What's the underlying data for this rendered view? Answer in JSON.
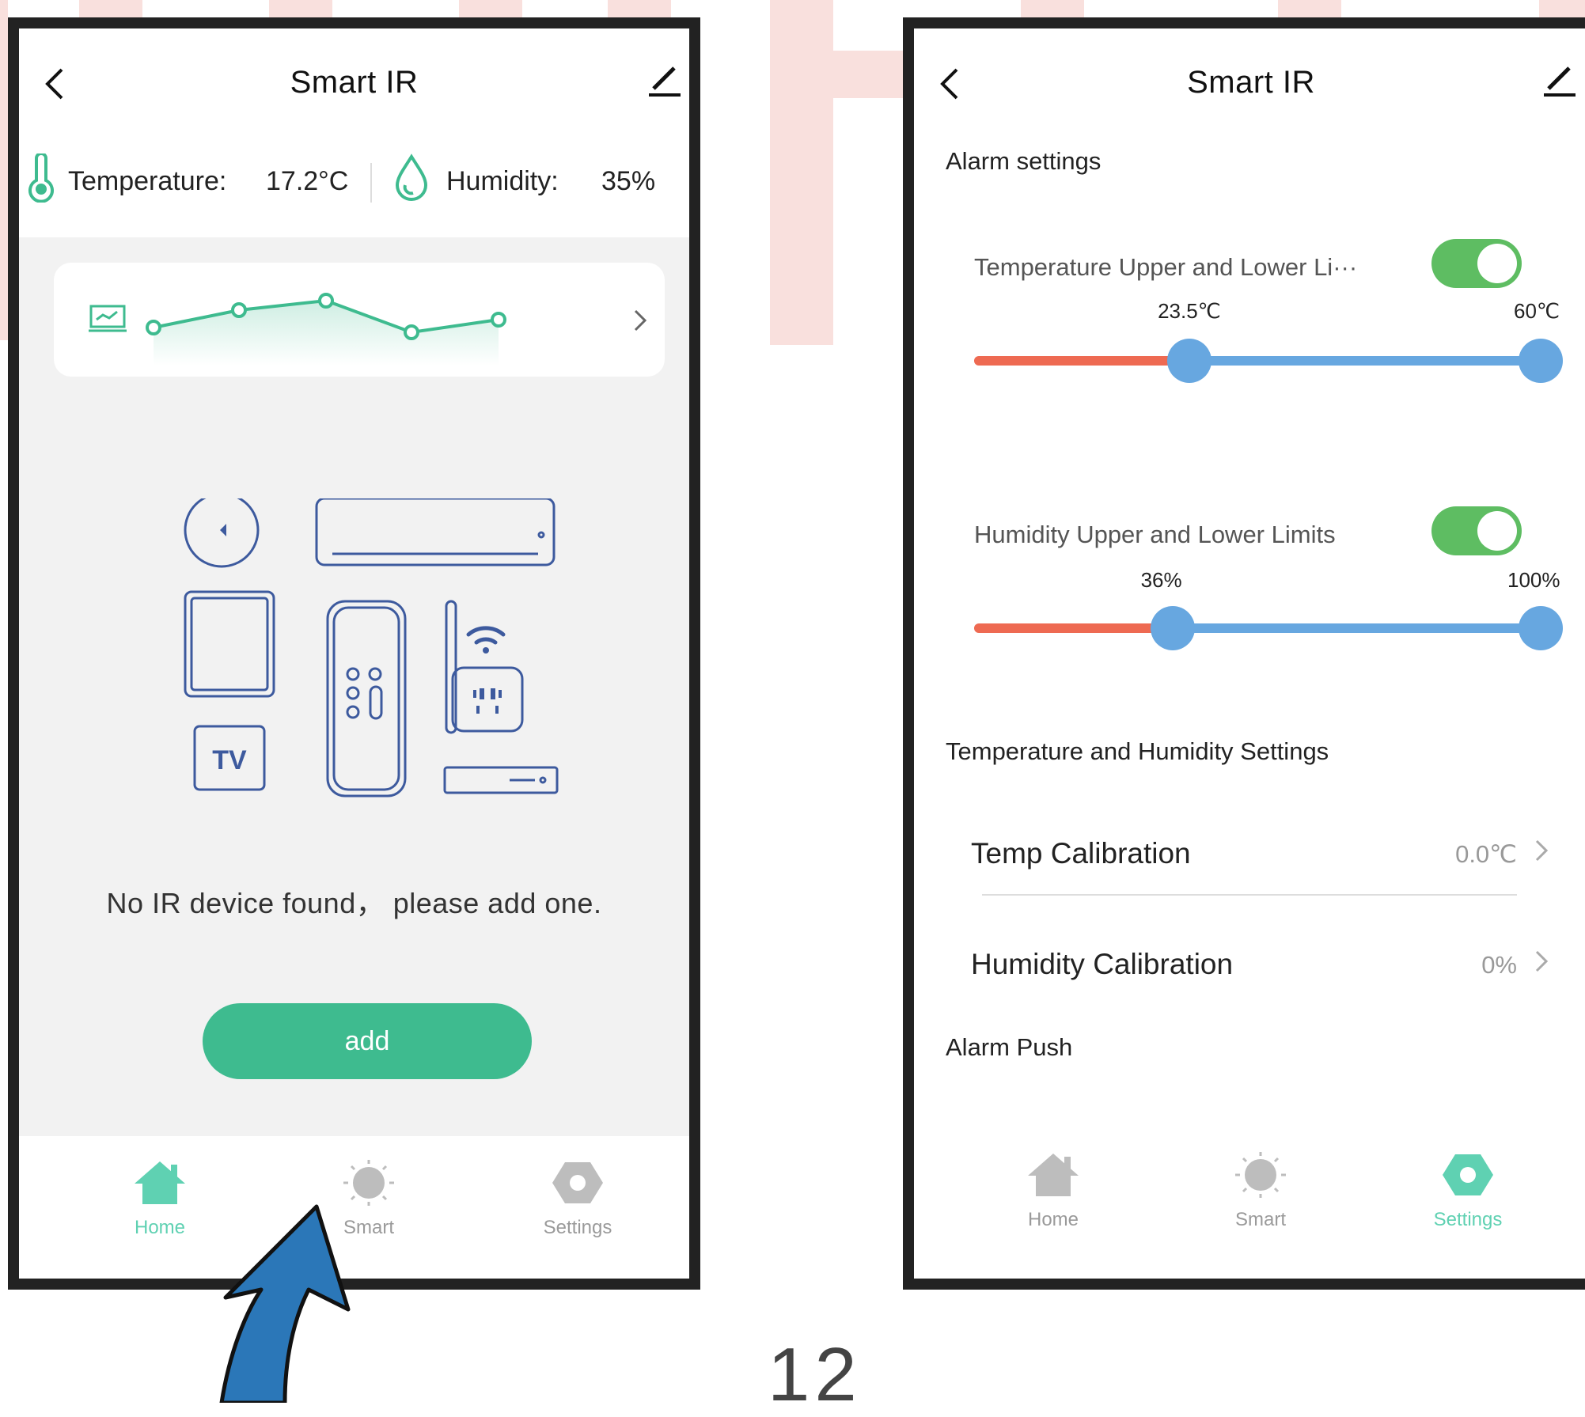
{
  "left_screen": {
    "title": "Smart IR",
    "temperature_label": "Temperature:",
    "temperature_value": "17.2°C",
    "humidity_label": "Humidity:",
    "humidity_value": "35%",
    "empty_message": "No IR device found， please add one.",
    "add_button": "add",
    "illustration_tv_label": "TV",
    "tabs": [
      {
        "label": "Home",
        "icon": "home-icon",
        "active": true
      },
      {
        "label": "Smart",
        "icon": "sun-icon",
        "active": false
      },
      {
        "label": "Settings",
        "icon": "hexagon-settings-icon",
        "active": false
      }
    ]
  },
  "right_screen": {
    "title": "Smart IR",
    "alarm_settings_heading": "Alarm settings",
    "temp_limit": {
      "label": "Temperature Upper and Lower Li···",
      "enabled": true,
      "lower_text": "23.5℃",
      "upper_text": "60℃",
      "lower_fraction": 0.38,
      "upper_fraction": 1.0
    },
    "humidity_limit": {
      "label": "Humidity Upper and Lower Limits",
      "enabled": true,
      "lower_text": "36%",
      "upper_text": "100%",
      "lower_fraction": 0.35,
      "upper_fraction": 1.0
    },
    "th_settings_heading": "Temperature and Humidity Settings",
    "temp_calibration": {
      "name": "Temp Calibration",
      "value": "0.0℃"
    },
    "humidity_calibration": {
      "name": "Humidity Calibration",
      "value": "0%"
    },
    "alarm_push_heading": "Alarm Push",
    "tabs": [
      {
        "label": "Home",
        "icon": "home-icon",
        "active": false
      },
      {
        "label": "Smart",
        "icon": "sun-icon",
        "active": false
      },
      {
        "label": "Settings",
        "icon": "hexagon-settings-icon",
        "active": true
      }
    ]
  },
  "page_number": "12",
  "colors": {
    "accent_green": "#3ebb8f",
    "active_tab": "#5fd1b2",
    "toggle_on": "#5ebd62",
    "slider_blue": "#67a7e0",
    "slider_red": "#ee6a52",
    "pink_background": "#f9e0dd",
    "arrow_blue": "#2b77b8"
  }
}
